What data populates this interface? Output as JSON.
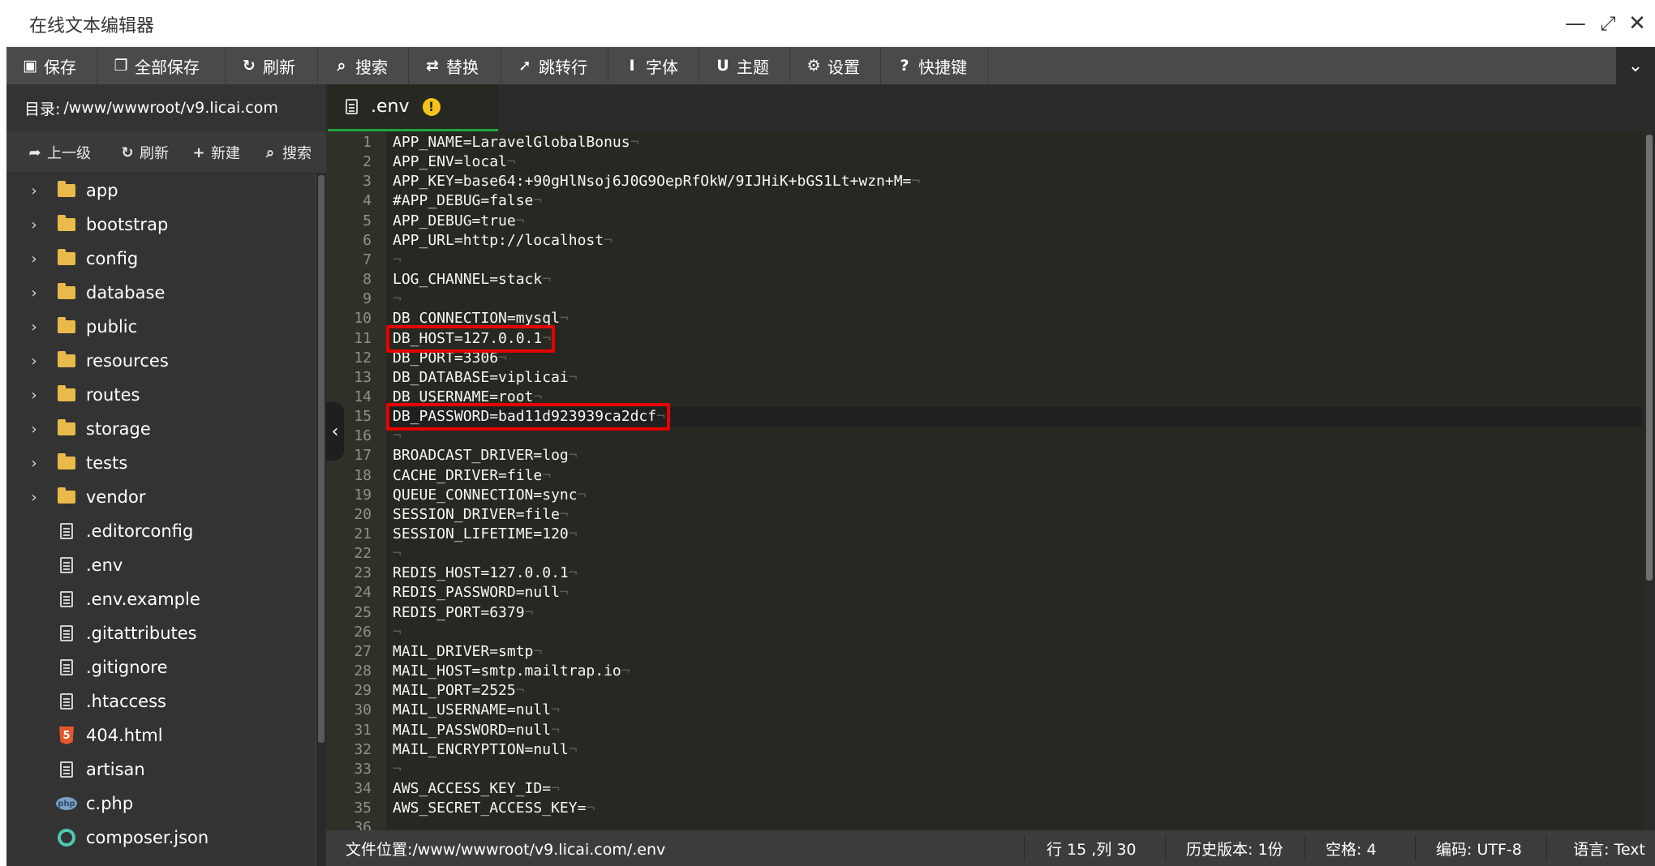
{
  "window": {
    "title": "在线文本编辑器",
    "minimize": "—",
    "maximize": "⤢",
    "close": "✕"
  },
  "toolbar": {
    "items": [
      {
        "label": "保存",
        "icon": "save-icon",
        "glyph": "▣"
      },
      {
        "label": "全部保存",
        "icon": "save-all-icon",
        "glyph": "❐"
      },
      {
        "label": "刷新",
        "icon": "refresh-icon",
        "glyph": "↻"
      },
      {
        "label": "搜索",
        "icon": "search-icon",
        "glyph": "⌕"
      },
      {
        "label": "替换",
        "icon": "replace-icon",
        "glyph": "⇄"
      },
      {
        "label": "跳转行",
        "icon": "goto-line-icon",
        "glyph": "➚"
      },
      {
        "label": "字体",
        "icon": "font-icon",
        "glyph": "I"
      },
      {
        "label": "主题",
        "icon": "theme-icon",
        "glyph": "U"
      },
      {
        "label": "设置",
        "icon": "gear-icon",
        "glyph": "⚙"
      },
      {
        "label": "快捷键",
        "icon": "help-icon",
        "glyph": "?"
      }
    ],
    "more": "⌄"
  },
  "sidebar": {
    "dir_label": "目录:",
    "dir_path": "/www/wwwroot/v9.licai.com",
    "buttons": [
      {
        "label": "上一级",
        "icon": "arrow-up-level-icon",
        "glyph": "➦"
      },
      {
        "label": "刷新",
        "icon": "refresh-icon",
        "glyph": "↻"
      },
      {
        "label": "新建",
        "icon": "plus-icon",
        "glyph": "+"
      },
      {
        "label": "搜索",
        "icon": "search-icon",
        "glyph": "⌕"
      }
    ],
    "tree": [
      {
        "name": "app",
        "type": "folder"
      },
      {
        "name": "bootstrap",
        "type": "folder"
      },
      {
        "name": "config",
        "type": "folder"
      },
      {
        "name": "database",
        "type": "folder"
      },
      {
        "name": "public",
        "type": "folder"
      },
      {
        "name": "resources",
        "type": "folder"
      },
      {
        "name": "routes",
        "type": "folder"
      },
      {
        "name": "storage",
        "type": "folder"
      },
      {
        "name": "tests",
        "type": "folder"
      },
      {
        "name": "vendor",
        "type": "folder"
      },
      {
        "name": ".editorconfig",
        "type": "doc"
      },
      {
        "name": ".env",
        "type": "doc"
      },
      {
        "name": ".env.example",
        "type": "doc"
      },
      {
        "name": ".gitattributes",
        "type": "doc"
      },
      {
        "name": ".gitignore",
        "type": "doc"
      },
      {
        "name": ".htaccess",
        "type": "doc"
      },
      {
        "name": "404.html",
        "type": "html"
      },
      {
        "name": "artisan",
        "type": "doc"
      },
      {
        "name": "c.php",
        "type": "php"
      },
      {
        "name": "composer.json",
        "type": "json"
      }
    ]
  },
  "editor": {
    "tab": {
      "name": ".env",
      "warn_glyph": "!"
    },
    "active_line": 15,
    "highlighted_lines": [
      11,
      15
    ],
    "lines": [
      "APP_NAME=LaravelGlobalBonus",
      "APP_ENV=local",
      "APP_KEY=base64:+90gHlNsoj6J0G9OepRfOkW/9IJHiK+bGS1Lt+wzn+M=",
      "#APP_DEBUG=false",
      "APP_DEBUG=true",
      "APP_URL=http://localhost",
      "",
      "LOG_CHANNEL=stack",
      "",
      "DB_CONNECTION=mysql",
      "DB_HOST=127.0.0.1",
      "DB_PORT=3306",
      "DB_DATABASE=viplicai",
      "DB_USERNAME=root",
      "DB_PASSWORD=bad11d923939ca2dcf",
      "",
      "BROADCAST_DRIVER=log",
      "CACHE_DRIVER=file",
      "QUEUE_CONNECTION=sync",
      "SESSION_DRIVER=file",
      "SESSION_LIFETIME=120",
      "",
      "REDIS_HOST=127.0.0.1",
      "REDIS_PASSWORD=null",
      "REDIS_PORT=6379",
      "",
      "MAIL_DRIVER=smtp",
      "MAIL_HOST=smtp.mailtrap.io",
      "MAIL_PORT=2525",
      "MAIL_USERNAME=null",
      "MAIL_PASSWORD=null",
      "MAIL_ENCRYPTION=null",
      "",
      "AWS_ACCESS_KEY_ID=",
      "AWS_SECRET_ACCESS_KEY=",
      ""
    ],
    "eol_glyph": "¬",
    "collapse_glyph": "‹"
  },
  "statusbar": {
    "file_location": "文件位置:/www/wwwroot/v9.licai.com/.env",
    "cursor": "行 15 ,列 30",
    "history": "历史版本: 1份",
    "indent": "空格: 4",
    "encoding": "编码: UTF-8",
    "language": "语言: Text"
  },
  "colors": {
    "accent_green": "#20a53a",
    "highlight_red": "#e60000",
    "editor_bg": "#272822",
    "folder": "#e9b949"
  }
}
